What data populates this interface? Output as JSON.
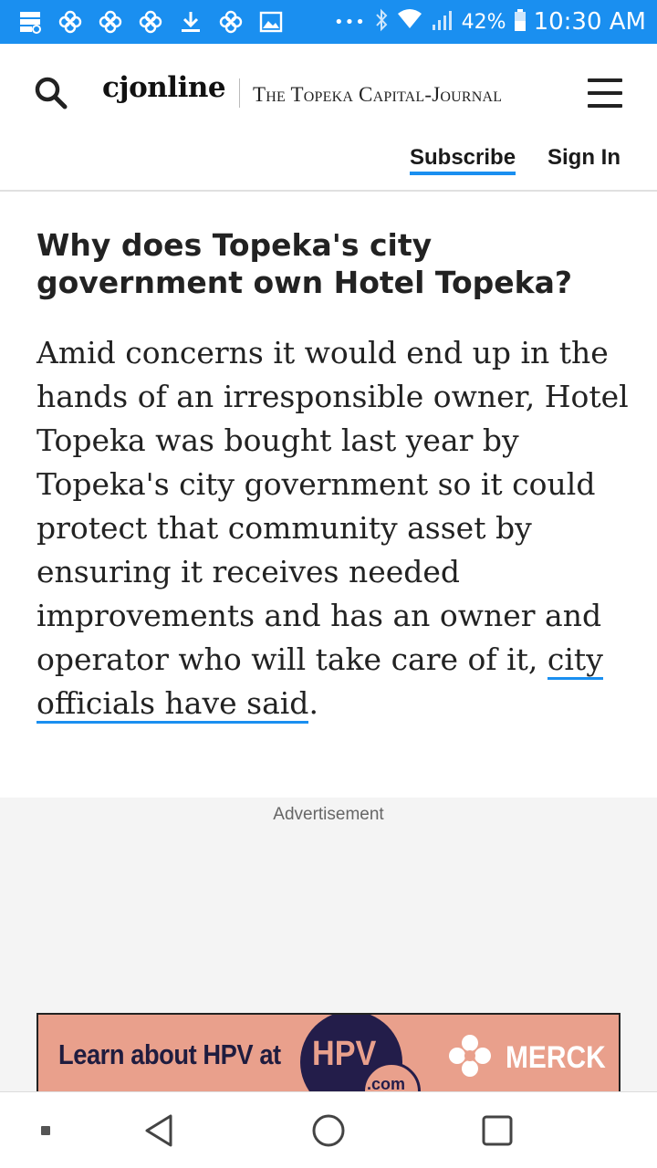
{
  "status_bar": {
    "icons_left": [
      "storage-icon",
      "pinwheel-icon",
      "pinwheel-icon",
      "pinwheel-icon",
      "download-icon",
      "pinwheel-icon",
      "image-icon"
    ],
    "overflow": "•••",
    "battery": "42%",
    "time": "10:30 AM"
  },
  "header": {
    "logo": "cjonline",
    "logo_sub": "The Topeka Capital-Journal",
    "subscribe": "Subscribe",
    "sign_in": "Sign In"
  },
  "article": {
    "headline": "Why does Topeka's city government own Hotel Topeka?",
    "body_text": "Amid concerns it would end up in the hands of an irresponsible owner, Hotel Topeka was bought last year by Topeka's city government so it could protect that community asset by ensuring it receives needed improvements and has an owner and operator who will take care of it, ",
    "body_link": "city officials have said",
    "body_end": "."
  },
  "ad": {
    "label": "Advertisement",
    "banner_text": "Learn about HPV at",
    "hpv": "HPV",
    "hpv_com": ".com",
    "brand": "MERCK"
  },
  "colors": {
    "accent": "#1a8ff0",
    "status_bar": "#1a8ff0",
    "ad_background": "#e9a08c",
    "ad_navy": "#231d4a"
  }
}
